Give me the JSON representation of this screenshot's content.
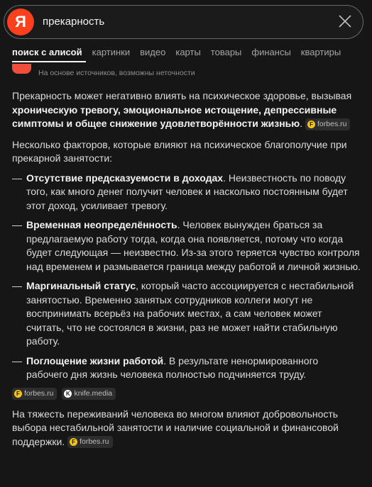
{
  "search": {
    "logo_letter": "Я",
    "query": "прекарность"
  },
  "tabs": [
    "поиск с алисой",
    "картинки",
    "видео",
    "карты",
    "товары",
    "финансы",
    "квартиры"
  ],
  "answer": {
    "disclaimer": "На основе источников, возможны неточности",
    "intro_text": "Прекарность может негативно влиять на психическое здоровье, вызывая ",
    "intro_bold": "хроническую тревогу, эмоциональное истощение, депрессивные симптомы и общее снижение удовлетворённости жизнью",
    "intro_end": ".",
    "lead": "Несколько факторов, которые влияют на психическое благополучие при прекарной занятости:",
    "items": [
      {
        "bold": "Отсутствие предсказуемости в доходах",
        "text": ". Неизвестность по поводу того, как много денег получит человек и насколько постоянным будет этот доход, усиливает тревогу."
      },
      {
        "bold": "Временная неопределённость",
        "text": ". Человек вынужден браться за предлагаемую работу тогда, когда она появляется, потому что когда будет следующая — неизвестно. Из-за этого теряется чувство контроля над временем и размывается граница между работой и личной жизнью."
      },
      {
        "bold": "Маргинальный статус",
        "text": ", который часто ассоциируется с нестабильной занятостью. Временно занятых сотрудников коллеги могут не воспринимать всерьёз на рабочих местах, а сам человек может считать, что не состоялся в жизни, раз не может найти стабильную работу."
      },
      {
        "bold": "Поглощение жизни работой",
        "text": ". В результате ненормированного рабочего дня жизнь человека полностью подчиняется труду."
      }
    ],
    "dash": "—",
    "conclusion": "На тяжесть переживаний человека во многом влияют добровольность выбора нестабильной занятости и наличие социальной и финансовой поддержки.",
    "sources": {
      "forbes": "forbes.ru",
      "knife": "knife.media",
      "forbes_letter": "F",
      "knife_letter": "K"
    }
  },
  "colors": {
    "background": "#161616",
    "brand": "#fc3f1d",
    "chip": "#2d2d2d",
    "forbes": "#f6c31a"
  }
}
